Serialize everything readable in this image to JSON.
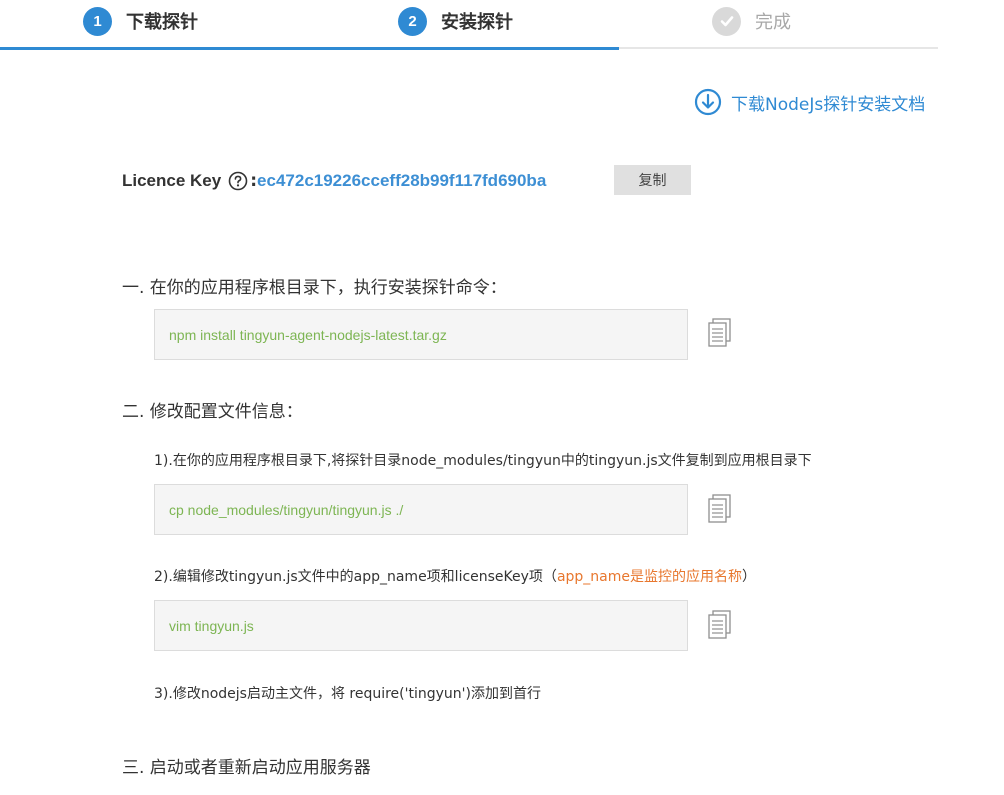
{
  "stepper": {
    "steps": [
      {
        "number": "1",
        "label": "下载探针",
        "state": "active"
      },
      {
        "number": "2",
        "label": "安装探针",
        "state": "active"
      },
      {
        "label": "完成",
        "state": "pending",
        "icon": "check-icon"
      }
    ],
    "progress_fraction": 0.66,
    "colors": {
      "active": "#2f8ad3",
      "pending": "#d9d9d9"
    }
  },
  "doc_link": {
    "label": "下载NodeJs探针安装文档",
    "icon": "download-circle-icon"
  },
  "licence": {
    "label": "Licence Key",
    "colon": ":",
    "key": "ec472c19226cceff28b99f117fd690ba",
    "copy_button": "复制",
    "help_icon": "question-circle-icon"
  },
  "sections": {
    "one": {
      "title": "一. 在你的应用程序根目录下，执行安装探针命令：",
      "command": "npm install tingyun-agent-nodejs-latest.tar.gz"
    },
    "two": {
      "title": "二. 修改配置文件信息：",
      "step1": "1).在你的应用程序根目录下,将探针目录node_modules/tingyun中的tingyun.js文件复制到应用根目录下",
      "command1": "cp node_modules/tingyun/tingyun.js ./",
      "step2_prefix": "2).编辑修改tingyun.js文件中的app_name项和licenseKey项（",
      "step2_highlight": "app_name是监控的应用名称",
      "step2_suffix": "）",
      "command2": "vim tingyun.js",
      "step3": "3).修改nodejs启动主文件，将 require('tingyun')添加到首行"
    },
    "three": {
      "title": "三. 启动或者重新启动应用服务器"
    }
  },
  "colors": {
    "accent": "#2f8ad3",
    "command_text": "#7db553",
    "highlight": "#e8772e"
  }
}
